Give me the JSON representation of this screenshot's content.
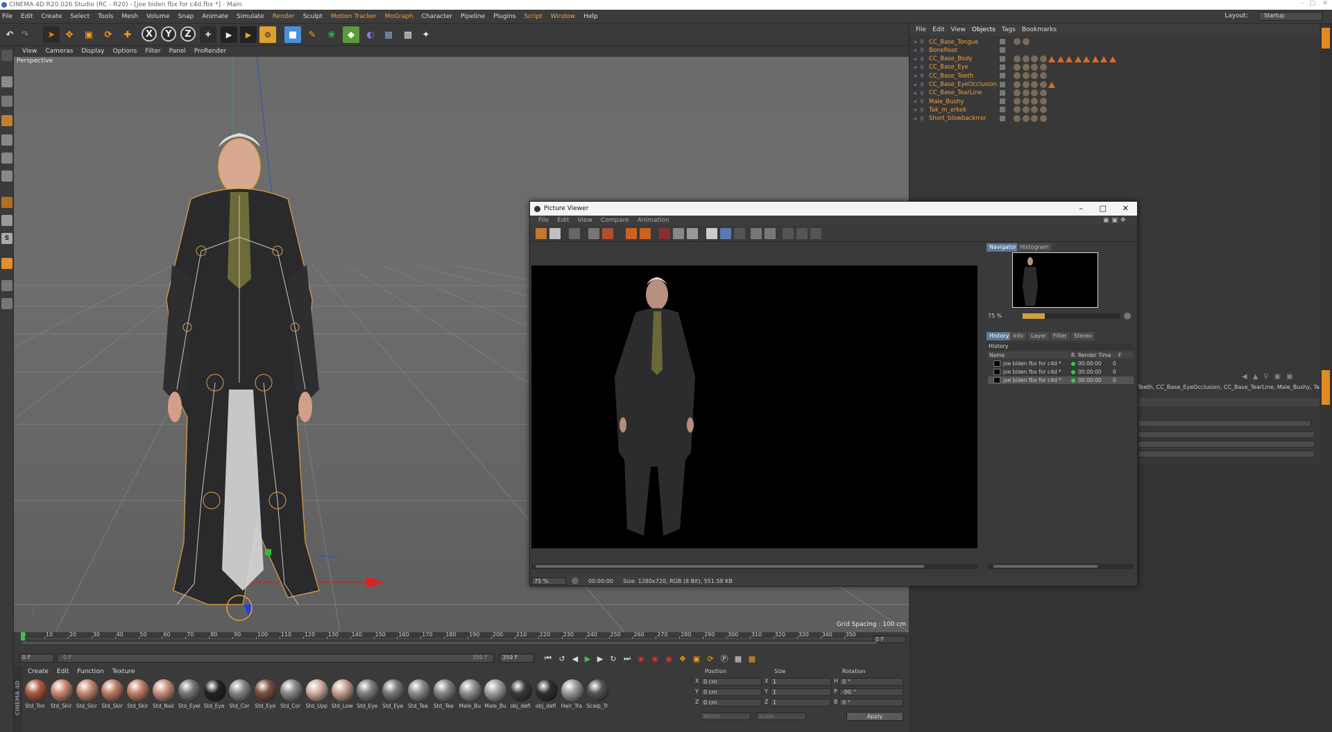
{
  "window": {
    "title": "CINEMA 4D R20.026 Studio (RC - R20) - [joe biden fbx for c4d.fbx *] - Main"
  },
  "menubar": {
    "items": [
      "File",
      "Edit",
      "Create",
      "Select",
      "Tools",
      "Mesh",
      "Volume",
      "Snap",
      "Animate",
      "Simulate",
      "Render",
      "Sculpt",
      "Motion Tracker",
      "MoGraph",
      "Character",
      "Pipeline",
      "Plugins",
      "Script",
      "Window",
      "Help"
    ],
    "highlighted": [
      "Render",
      "Motion Tracker",
      "MoGraph",
      "Script",
      "Window"
    ],
    "layout_label": "Layout:",
    "layout_value": "Startup"
  },
  "toolbar": {
    "axis_x": "X",
    "axis_y": "Y",
    "axis_z": "Z",
    "icons": [
      "undo-icon",
      "redo-icon",
      "select-icon",
      "move-icon",
      "scale-icon",
      "rotate-icon",
      "add-icon",
      "axis-x-icon",
      "axis-y-icon",
      "axis-z-icon",
      "world-icon",
      "render-view-icon",
      "render-pv-icon",
      "render-settings-icon",
      "cube-icon",
      "pen-icon",
      "subdiv-icon",
      "mograph-icon",
      "deformer-icon",
      "floor-icon",
      "camera-icon",
      "light-icon"
    ]
  },
  "viewport": {
    "menu": [
      "View",
      "Cameras",
      "Display",
      "Options",
      "Filter",
      "Panel",
      "ProRender"
    ],
    "label": "Perspective",
    "grid_spacing": "Grid Spacing : 100 cm"
  },
  "object_manager": {
    "menu": [
      "File",
      "Edit",
      "View",
      "Objects",
      "Tags",
      "Bookmarks"
    ],
    "active_menu": "Objects",
    "objects": [
      {
        "name": "CC_Base_Tongue"
      },
      {
        "name": "BoneRoot"
      },
      {
        "name": "CC_Base_Body"
      },
      {
        "name": "CC_Base_Eye"
      },
      {
        "name": "CC_Base_Teeth"
      },
      {
        "name": "CC_Base_EyeOcclusion"
      },
      {
        "name": "CC_Base_TearLine"
      },
      {
        "name": "Male_Bushy"
      },
      {
        "name": "Tak_m_erkek"
      },
      {
        "name": "Short_blowbackrrer"
      }
    ]
  },
  "attributes": {
    "text": "Teeth, CC_Base_EyeOcclusion, CC_Base_TearLine, Male_Bushy, Tak_m_erkek, Tak_n"
  },
  "picture_viewer": {
    "title": "Picture Viewer",
    "menu": [
      "File",
      "Edit",
      "View",
      "Compare",
      "Animation"
    ],
    "zoom": "75 %",
    "timecode": "00:00:00",
    "status": "Size: 1280x720, RGB (8 Bit), 551.58 KB",
    "nav_tabs": [
      "Navigator",
      "Histogram"
    ],
    "nav_active": "Navigator",
    "nav_zoom": "75 %",
    "panel_tabs": [
      "History",
      "Info",
      "Layer",
      "Filter",
      "Stereo"
    ],
    "panel_active": "History",
    "history_title": "History",
    "columns": [
      "Name",
      "R",
      "Render Time",
      "F"
    ],
    "history": [
      {
        "name": "joe biden fbx for c4d *",
        "time": "00:00:00",
        "frame": "0"
      },
      {
        "name": "joe biden fbx for c4d *",
        "time": "00:00:00",
        "frame": "0"
      },
      {
        "name": "joe biden fbx for c4d *",
        "time": "00:00:00",
        "frame": "0"
      }
    ]
  },
  "timeline": {
    "ticks": [
      "0",
      "10",
      "20",
      "30",
      "40",
      "50",
      "60",
      "70",
      "80",
      "90",
      "100",
      "110",
      "120",
      "130",
      "140",
      "150",
      "160",
      "170",
      "180",
      "190",
      "200",
      "210",
      "220",
      "230",
      "240",
      "250",
      "260",
      "270",
      "280",
      "290",
      "300",
      "310",
      "320",
      "330",
      "340",
      "350"
    ],
    "current_frame": "0 F",
    "start": "0 F",
    "end_label": "359 F",
    "end_field": "359 F",
    "min_field": "0 F"
  },
  "materials": {
    "menu": [
      "Create",
      "Edit",
      "Function",
      "Texture"
    ],
    "brand": "CINEMA 4D",
    "items": [
      {
        "label": "Std_Ton",
        "color": "#b05a40"
      },
      {
        "label": "Std_Skir",
        "color": "#c98870"
      },
      {
        "label": "Std_Skir",
        "color": "#c58a72"
      },
      {
        "label": "Std_Skir",
        "color": "#bd7c66"
      },
      {
        "label": "Std_Skir",
        "color": "#c48268"
      },
      {
        "label": "Std_Nail",
        "color": "#c99080"
      },
      {
        "label": "Std_Eyel",
        "color": "#777777"
      },
      {
        "label": "Std_Eye",
        "color": "#222222"
      },
      {
        "label": "Std_Cor",
        "color": "#888888"
      },
      {
        "label": "Std_Eye",
        "color": "#7a5040"
      },
      {
        "label": "Std_Cor",
        "color": "#8a8a8a"
      },
      {
        "label": "Std_Upp",
        "color": "#d0b0a0"
      },
      {
        "label": "Std_Low",
        "color": "#c8a090"
      },
      {
        "label": "Std_Eye",
        "color": "#808080"
      },
      {
        "label": "Std_Eye",
        "color": "#7a7a7a"
      },
      {
        "label": "Std_Tea",
        "color": "#8c8c8c"
      },
      {
        "label": "Std_Tea",
        "color": "#868686"
      },
      {
        "label": "Male_Bu",
        "color": "#909090"
      },
      {
        "label": "Male_Bu",
        "color": "#a0a0a0"
      },
      {
        "label": "obj_defi",
        "color": "#3a3a3a"
      },
      {
        "label": "obj_defi",
        "color": "#2e2e2e"
      },
      {
        "label": "Hair_Tra",
        "color": "#9a9a9a"
      },
      {
        "label": "Scalp_Tr",
        "color": "#555555"
      }
    ]
  },
  "coordinates": {
    "headers": [
      "Position",
      "Size",
      "Rotation"
    ],
    "rows": [
      {
        "axis": "X",
        "pos": "0 cm",
        "size_axis": "X",
        "size": "1",
        "rot_axis": "H",
        "rot": "0 °"
      },
      {
        "axis": "Y",
        "pos": "0 cm",
        "size_axis": "Y",
        "size": "1",
        "rot_axis": "P",
        "rot": "-90 °"
      },
      {
        "axis": "Z",
        "pos": "0 cm",
        "size_axis": "Z",
        "size": "1",
        "rot_axis": "B",
        "rot": "0 °"
      }
    ],
    "mode": "World",
    "scale": "Scale",
    "apply": "Apply"
  }
}
